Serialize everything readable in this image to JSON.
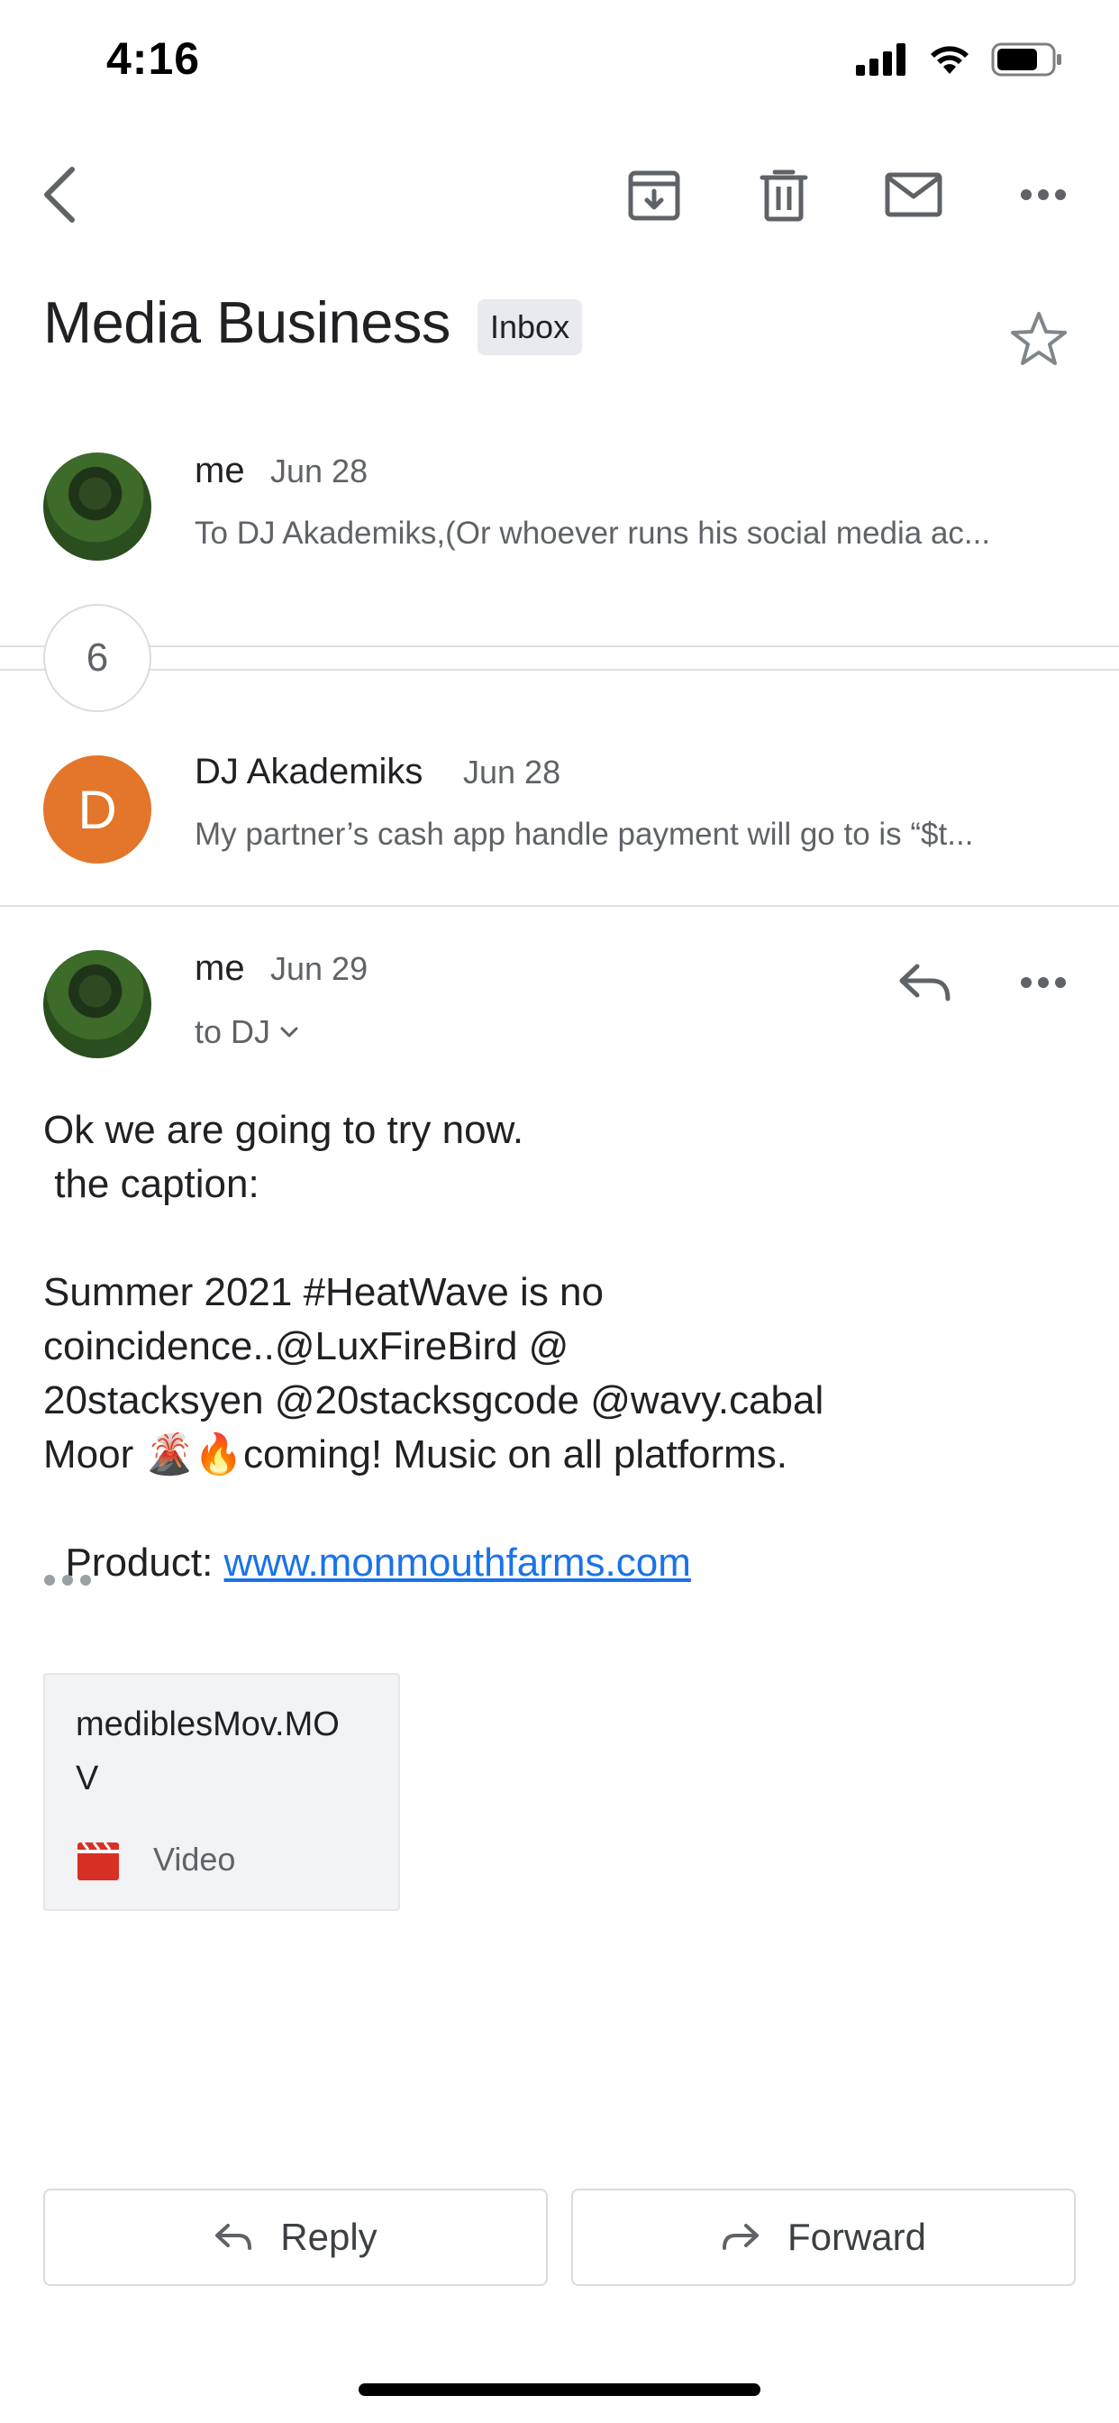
{
  "status_bar": {
    "time": "4:16"
  },
  "toolbar": {
    "back_icon": "chevron-left-icon",
    "archive_icon": "archive-icon",
    "delete_icon": "trash-icon",
    "mark_unread_icon": "mail-icon",
    "more_icon": "more-horizontal-icon"
  },
  "subject": {
    "title": "Media Business",
    "label": "Inbox"
  },
  "messages": [
    {
      "sender": "me",
      "date": "Jun 28",
      "snippet": "To DJ Akademiks,(Or whoever runs his social media ac..."
    },
    {
      "sender": "DJ Akademiks",
      "avatar_letter": "D",
      "date": "Jun 28",
      "snippet": "My partner’s cash app handle payment will go to is “$t..."
    }
  ],
  "collapsed_count": "6",
  "expanded": {
    "sender": "me",
    "date": "Jun 29",
    "recipients": "to DJ",
    "body_lines": [
      "Ok we are going to try now.",
      " the caption:",
      "",
      "Summer 2021 #HeatWave is no",
      "coincidence..@LuxFireBird @",
      "20stacksyen @20stacksgcode @wavy.cabal",
      "Moor 🌋🔥coming! Music on all platforms."
    ],
    "product_label": "Product: ",
    "product_link": "www.monmouthfarms.com",
    "attachment": {
      "name_line1": "mediblesMov.MO",
      "name_line2": "V",
      "type": "Video"
    }
  },
  "actions": {
    "reply": "Reply",
    "forward": "Forward"
  },
  "colors": {
    "link": "#1a73e8",
    "avatar_orange": "#e3762a",
    "video_icon": "#d93025"
  }
}
